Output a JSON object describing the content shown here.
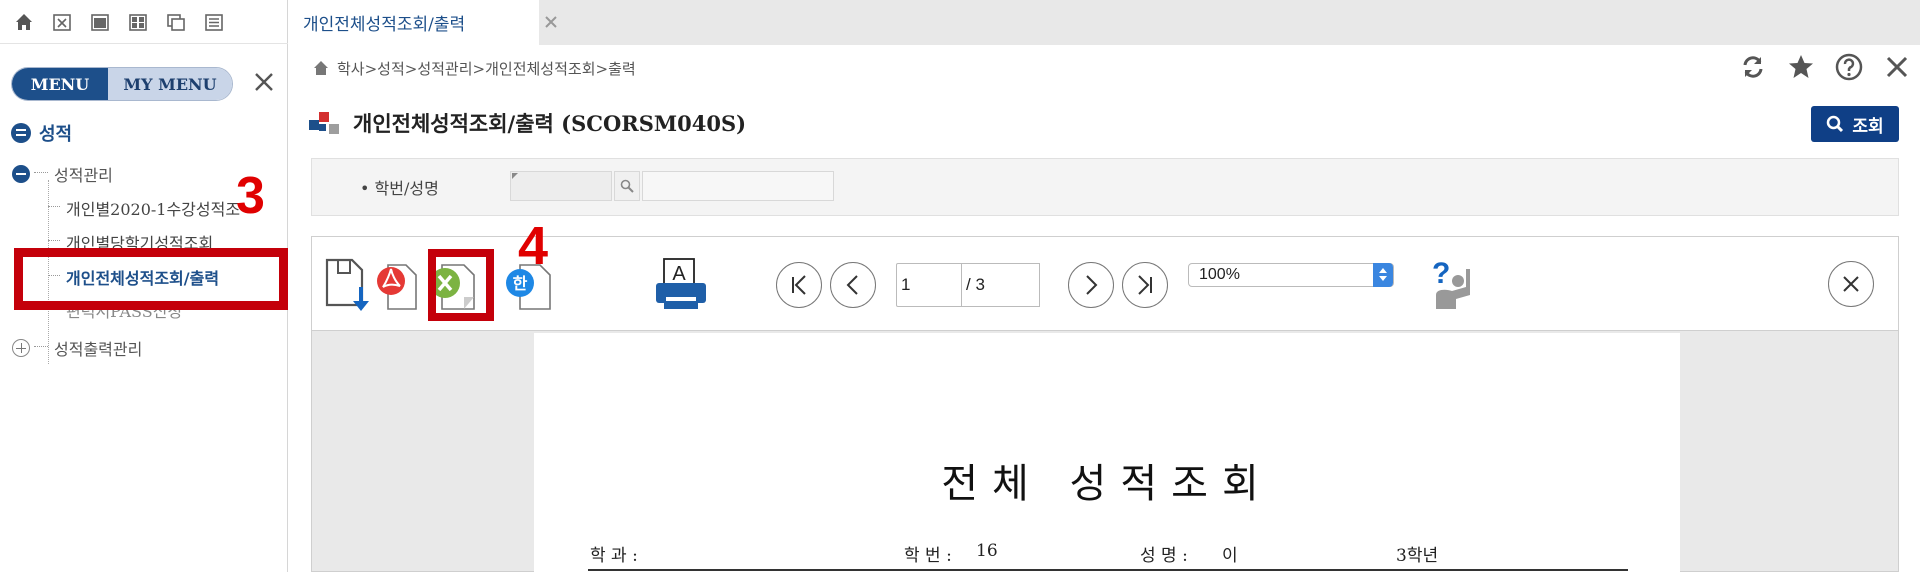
{
  "left_panel": {
    "menu_tabs": [
      "MENU",
      "MY MENU"
    ],
    "root_label": "성적",
    "groups": [
      {
        "label": "성적관리",
        "expanded": true
      },
      {
        "label": "성적출력관리",
        "expanded": false
      }
    ],
    "leaves": [
      "개인별2020-1수강성적조",
      "개인별당학기성적조회",
      "개인전체성적조회/출력",
      "편력서PASS신청"
    ],
    "annotation_3": "3"
  },
  "tab": {
    "label": "개인전체성적조회/출력"
  },
  "breadcrumb": "학사>성적>성적관리>개인전체성적조회>출력",
  "page": {
    "title": "개인전체성적조회/출력 (SCORSM040S)",
    "search_button": "조회",
    "filter_label": "• 학번/성명"
  },
  "viewer": {
    "current_page": "1",
    "total_pages": "/ 3",
    "zoom": "100%",
    "annotation_4": "4",
    "doc_title": "전체 성적조회",
    "fields": {
      "dept_label": "학 과 :",
      "id_label": "학 번 :",
      "id_value": "16",
      "name_label": "성 명 :",
      "name_value": "이",
      "grade_value": "3학년"
    }
  },
  "colors": {
    "primary": "#1d4f8a",
    "highlight_red": "#c4000a",
    "search_btn": "#0f3f86"
  }
}
